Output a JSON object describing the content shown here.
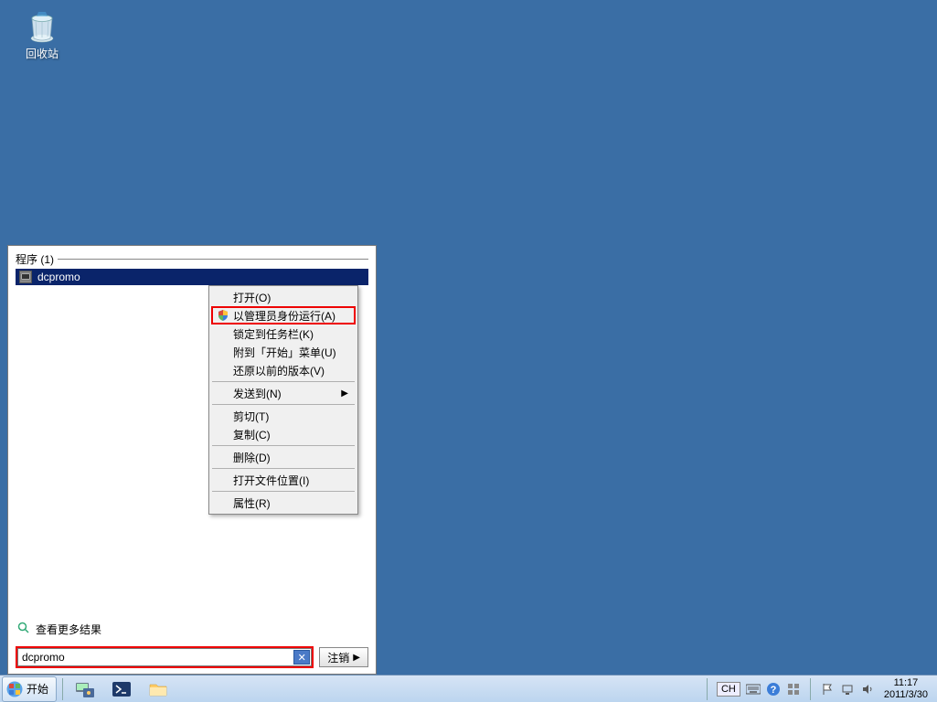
{
  "desktop": {
    "recycle_bin_label": "回收站"
  },
  "start_panel": {
    "programs_header": "程序 (1)",
    "program_name": "dcpromo",
    "see_more": "查看更多结果",
    "search_value": "dcpromo",
    "logout_label": "注销"
  },
  "context_menu": {
    "open": "打开(O)",
    "run_as_admin": "以管理员身份运行(A)",
    "pin_taskbar": "锁定到任务栏(K)",
    "pin_start": "附到「开始」菜单(U)",
    "restore_prev": "还原以前的版本(V)",
    "send_to": "发送到(N)",
    "cut": "剪切(T)",
    "copy": "复制(C)",
    "delete": "删除(D)",
    "open_location": "打开文件位置(I)",
    "properties": "属性(R)"
  },
  "taskbar": {
    "start_label": "开始",
    "lang": "CH",
    "time": "11:17",
    "date": "2011/3/30"
  }
}
